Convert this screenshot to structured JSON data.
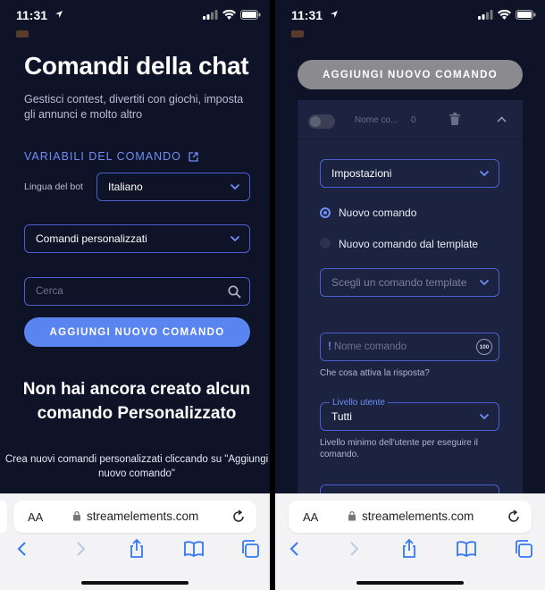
{
  "left_screen": {
    "status_time": "11:31",
    "title": "Comandi della chat",
    "subtitle": "Gestisci contest, divertiti con giochi, imposta gli annunci e molto altro",
    "variables_link": "VARIABILI DEL COMANDO",
    "bot_language_label": "Lingua del bot",
    "bot_language_value": "Italiano",
    "command_type_value": "Comandi personalizzati",
    "search_placeholder": "Cerca",
    "add_button": "AGGIUNGI NUOVO COMANDO",
    "empty_title": "Non hai ancora creato alcun comando Personalizzato",
    "empty_text": "Crea nuovi comandi personalizzati cliccando su \"Aggiungi nuovo comando\"",
    "url_aa": "AA",
    "url": "streamelements.com"
  },
  "right_screen": {
    "status_time": "11:31",
    "add_button": "AGGIUNGI NUOVO COMANDO",
    "command_name": "Nome co...",
    "command_count": "0",
    "settings_value": "Impostazioni",
    "radio_new": "Nuovo comando",
    "radio_template": "Nuovo comando dal template",
    "template_placeholder": "Scegli un comando template",
    "command_prefix": "!",
    "command_placeholder": "Nome comando",
    "char_badge": "100",
    "command_help": "Che cosa attiva la risposta?",
    "user_level_label": "Livello utente",
    "user_level_value": "Tutti",
    "user_level_help": "Livello minimo dell'utente per eseguire il comando.",
    "url_aa": "AA",
    "url": "streamelements.com"
  },
  "colors": {
    "background": "#0e1328",
    "accent": "#5a85f0",
    "link": "#6f8ef7",
    "panel": "#1b2340",
    "disabled_button": "#8b8b8f"
  },
  "icons": [
    "location-arrow-icon",
    "signal-icon",
    "wifi-icon",
    "battery-icon",
    "external-link-icon",
    "chevron-down-icon",
    "search-icon",
    "trash-icon",
    "chevron-up-icon",
    "lock-icon",
    "reload-icon",
    "back-icon",
    "forward-icon",
    "share-icon",
    "bookmarks-icon",
    "tabs-icon"
  ]
}
